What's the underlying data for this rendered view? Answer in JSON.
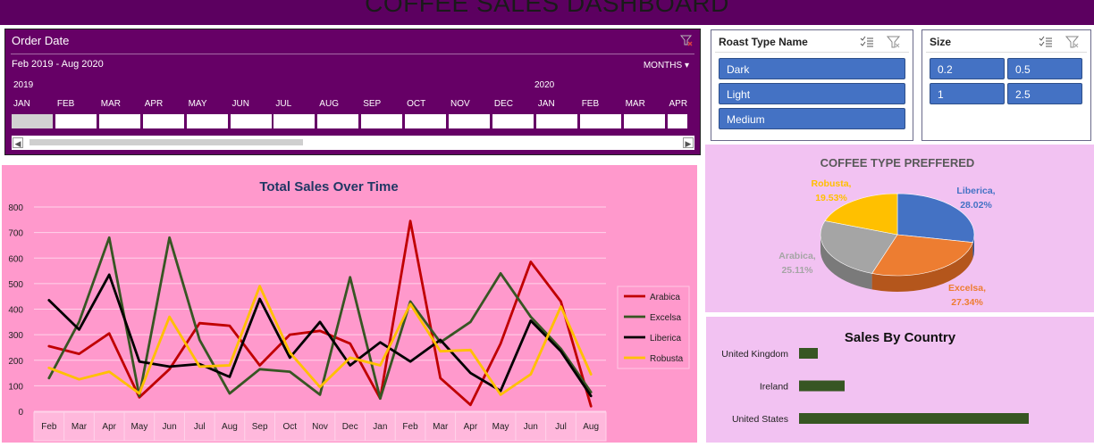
{
  "dashboard_title": "COFFEE SALES DASHBOARD",
  "timeline": {
    "header": "Order Date",
    "range_label": "Feb 2019 - Aug 2020",
    "period_selector": "MONTHS",
    "years": [
      "2019",
      "2020"
    ],
    "months": [
      "JAN",
      "FEB",
      "MAR",
      "APR",
      "MAY",
      "JUN",
      "JUL",
      "AUG",
      "SEP",
      "OCT",
      "NOV",
      "DEC",
      "JAN",
      "FEB",
      "MAR",
      "APR"
    ],
    "selected_month_index": 1
  },
  "roast_slicer": {
    "title": "Roast Type Name",
    "items": [
      "Dark",
      "Light",
      "Medium"
    ]
  },
  "size_slicer": {
    "title": "Size",
    "items": [
      "0.2",
      "0.5",
      "1",
      "2.5"
    ]
  },
  "colors": {
    "arabica": "#c00000",
    "excelsa": "#375623",
    "liberica": "#000000",
    "robusta": "#ffc000",
    "pie_liberica": "#4472c4",
    "pie_excelsa": "#ed7d31",
    "pie_arabica": "#a5a5a5",
    "pie_robusta": "#ffc000",
    "bar": "#375623"
  },
  "chart_data": [
    {
      "type": "line",
      "title": "Total Sales  Over Time",
      "categories": [
        "Feb",
        "Mar",
        "Apr",
        "May",
        "Jun",
        "Jul",
        "Aug",
        "Sep",
        "Oct",
        "Nov",
        "Dec",
        "Jan",
        "Feb",
        "Mar",
        "Apr",
        "May",
        "Jun",
        "Jul",
        "Aug"
      ],
      "ylim": [
        0,
        800
      ],
      "yticks": [
        "0",
        "100",
        "200",
        "300",
        "400",
        "500",
        "600",
        "700",
        "800"
      ],
      "grid": true,
      "legend": "right",
      "series": [
        {
          "name": "Arabica",
          "values": [
            255,
            225,
            305,
            55,
            165,
            345,
            335,
            180,
            300,
            315,
            265,
            50,
            745,
            130,
            25,
            265,
            585,
            430,
            20
          ]
        },
        {
          "name": "Excelsa",
          "values": [
            130,
            350,
            680,
            60,
            680,
            280,
            70,
            165,
            155,
            65,
            525,
            50,
            430,
            270,
            350,
            540,
            370,
            245,
            75
          ]
        },
        {
          "name": "Liberica",
          "values": [
            435,
            320,
            535,
            195,
            175,
            185,
            135,
            440,
            210,
            350,
            180,
            270,
            195,
            280,
            150,
            80,
            355,
            235,
            60
          ]
        },
        {
          "name": "Robusta",
          "values": [
            170,
            125,
            155,
            70,
            370,
            175,
            180,
            490,
            230,
            95,
            210,
            180,
            420,
            235,
            240,
            65,
            145,
            410,
            145
          ]
        }
      ]
    },
    {
      "type": "pie",
      "title": "COFFEE TYPE PREFFERED",
      "labels": [
        "Liberica",
        "Excelsa",
        "Arabica",
        "Robusta"
      ],
      "values": [
        28.02,
        27.34,
        25.11,
        19.53
      ],
      "data_labels": [
        "Liberica,\n28.02%",
        "Excelsa,\n27.34%",
        "Arabica,\n25.11%",
        "Robusta,\n19.53%"
      ]
    },
    {
      "type": "bar",
      "title": "Sales By Country",
      "categories": [
        "United Kingdom",
        "Ireland",
        "United States"
      ],
      "values": [
        21,
        51,
        257
      ]
    }
  ]
}
